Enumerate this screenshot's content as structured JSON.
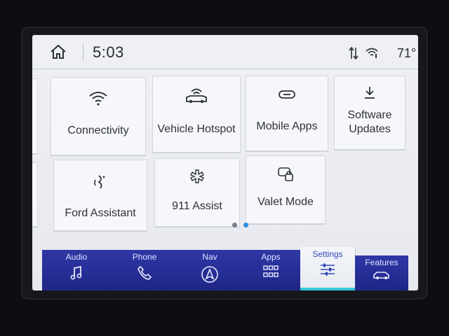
{
  "status": {
    "time": "5:03",
    "temperature": "71°"
  },
  "tiles": [
    {
      "label": "Connectivity",
      "icon": "wifi-icon"
    },
    {
      "label": "Vehicle Hotspot",
      "icon": "vehicle-hotspot-icon"
    },
    {
      "label": "Mobile Apps",
      "icon": "link-icon"
    },
    {
      "label": "Software Updates",
      "label_line1": "Software",
      "label_line2": "Updates",
      "icon": "download-icon"
    },
    {
      "label": "Ford Assistant",
      "icon": "assistant-icon"
    },
    {
      "label": "911 Assist",
      "icon": "emergency-icon"
    },
    {
      "label": "Valet Mode",
      "icon": "phone-lock-icon"
    }
  ],
  "pager": {
    "pages": 2,
    "current": 2
  },
  "nav": [
    {
      "label": "Audio",
      "icon": "music-note-icon"
    },
    {
      "label": "Phone",
      "icon": "phone-icon"
    },
    {
      "label": "Nav",
      "icon": "navigation-icon"
    },
    {
      "label": "Apps",
      "icon": "apps-grid-icon"
    },
    {
      "label": "Settings",
      "icon": "settings-sliders-icon",
      "active": true
    },
    {
      "label": "Features",
      "icon": "car-icon"
    }
  ],
  "colors": {
    "nav_bg": "#2a31a0",
    "active_accent": "#35c8d8",
    "active_text": "#3047b8",
    "pager_active": "#2d8fe0",
    "pager_inactive": "#7a7f8a"
  }
}
